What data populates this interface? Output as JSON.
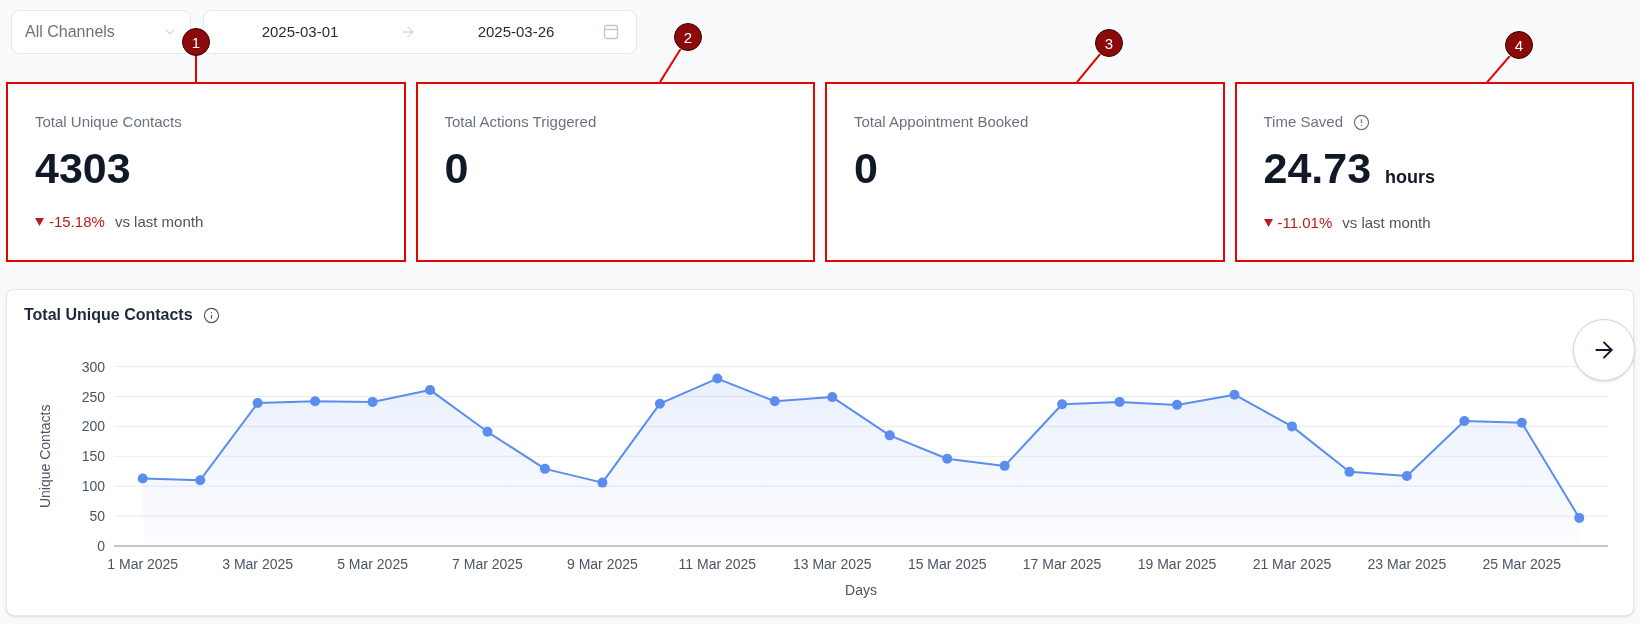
{
  "filters": {
    "channel": {
      "value": "All Channels"
    },
    "date_range": {
      "start": "2025-03-01",
      "end": "2025-03-26"
    }
  },
  "stat_cards": [
    {
      "marker": "1",
      "label": "Total Unique Contacts",
      "value": "4303",
      "change": {
        "decrease": true,
        "value": "-15.18%",
        "label": "vs last month"
      }
    },
    {
      "marker": "2",
      "label": "Total Actions Triggered",
      "value": "0"
    },
    {
      "marker": "3",
      "label": "Total Appointment Booked",
      "value": "0"
    },
    {
      "marker": "4",
      "label": "Time Saved",
      "info_icon": true,
      "value": "24.73",
      "unit": "hours",
      "change": {
        "decrease": true,
        "value": "-11.01%",
        "label": "vs last month"
      }
    }
  ],
  "chart_panel": {
    "info_icon": true,
    "chart_data": {
      "type": "area",
      "title": "Total Unique Contacts",
      "xlabel": "Days",
      "ylabel": "Unique Contacts",
      "grid": true,
      "categories": [
        "1 Mar 2025",
        null,
        "3 Mar 2025",
        null,
        "5 Mar 2025",
        null,
        "7 Mar 2025",
        null,
        "9 Mar 2025",
        null,
        "11 Mar 2025",
        null,
        "13 Mar 2025",
        null,
        "15 Mar 2025",
        null,
        "17 Mar 2025",
        null,
        "19 Mar 2025",
        null,
        "21 Mar 2025",
        null,
        "23 Mar 2025",
        null,
        "25 Mar 2025",
        null
      ],
      "ylim": [
        0,
        300
      ],
      "yticks": [
        0,
        50,
        100,
        150,
        200,
        250,
        300
      ],
      "series": [
        {
          "color": "#5b8def",
          "values": [
            113,
            110,
            239,
            242,
            241,
            261,
            191,
            129,
            106,
            238,
            280,
            242,
            249,
            185,
            146,
            134,
            237,
            241,
            236,
            253,
            200,
            124,
            117,
            209,
            206,
            47
          ]
        }
      ]
    }
  }
}
